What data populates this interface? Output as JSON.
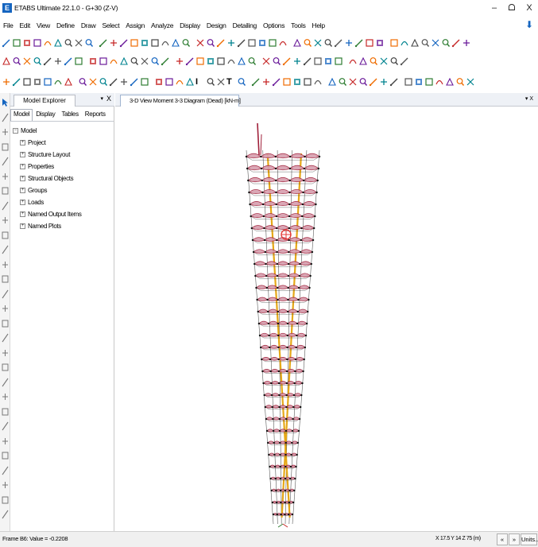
{
  "window": {
    "title": "ETABS Ultimate 22.1.0 - G+30 (Z-V)",
    "app_icon_letter": "E",
    "controls": {
      "minimize": "–",
      "restore": "ᗝ",
      "close": "X"
    }
  },
  "menu": [
    "File",
    "Edit",
    "View",
    "Define",
    "Draw",
    "Select",
    "Assign",
    "Analyze",
    "Display",
    "Design",
    "Detailing",
    "Options",
    "Tools",
    "Help"
  ],
  "toolbar_text": {
    "i_beam": "I",
    "t_beam": "T"
  },
  "model_explorer": {
    "title": "Model Explorer",
    "menu_glyph": "▾",
    "close_glyph": "X",
    "tabs": [
      "Model",
      "Display",
      "Tables",
      "Reports"
    ],
    "tree": {
      "root": "Model",
      "children": [
        "Project",
        "Structure Layout",
        "Properties",
        "Structural Objects",
        "Groups",
        "Loads",
        "Named Output Items",
        "Named Plots"
      ]
    }
  },
  "view": {
    "tab_title": "3-D View   Moment 3-3 Diagram   (Dead)  [kN-m]",
    "menu_glyph": "▾ X"
  },
  "statusbar": {
    "left": "Frame B6:  Value = -0.2208",
    "coords": "X 17.5  Y 14  Z 75 (m)",
    "prev": "«",
    "next": "»",
    "units": "Units..."
  },
  "colors": {
    "app_icon": "#1565c0",
    "moment_diagram": "#a0203a",
    "moment_fill": "#d9a0b0",
    "columns": "#e6a817",
    "frame_lines": "#333333",
    "joints": "#111111"
  }
}
